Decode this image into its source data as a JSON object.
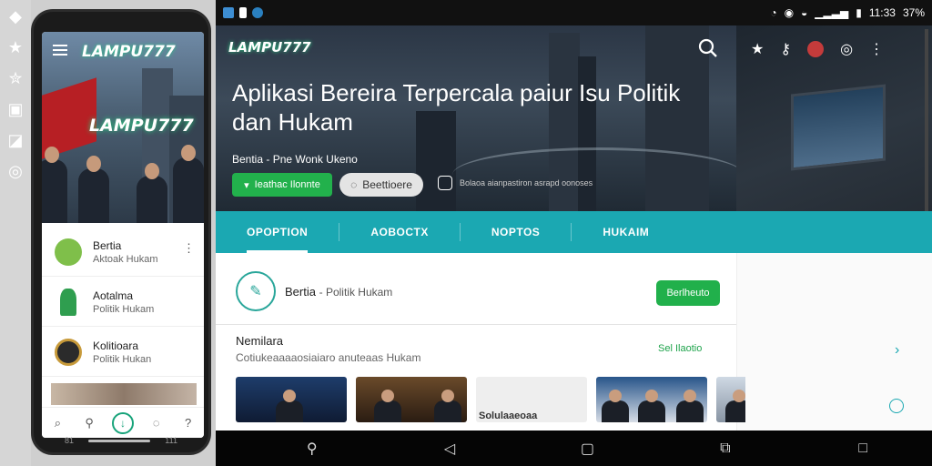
{
  "rail": {
    "icons": [
      "diamond-icon",
      "star-icon",
      "star-outline-icon",
      "briefcase-icon",
      "no-image-icon",
      "circle-dot-icon"
    ]
  },
  "phone": {
    "logo": "LAMPU777",
    "hero_logo": "LAMPU777",
    "list": [
      {
        "title": "Bertia",
        "subtitle": "Aktoak Hukam",
        "kebab": "⋮"
      },
      {
        "title": "Aotalma",
        "subtitle": "Politik Hukam",
        "kebab": ""
      },
      {
        "title": "Kolitioara",
        "subtitle": "Politik Hukan",
        "kebab": ""
      }
    ],
    "bottom_left": "81",
    "bottom_right": "111"
  },
  "status": {
    "time": "11:33",
    "pct": "37%"
  },
  "hero": {
    "logo": "LAMPU777",
    "title": "Aplikasi Bereira Terpercala paiur Isu Politik dan Hukam",
    "subtitle": "Bentia - Pne Wonk Ukeno",
    "btn_primary": "Ieathac Ilonnte",
    "btn_secondary": "Beettioere",
    "extra_text": "Bolaoa aianpastiron asrapd oonoses"
  },
  "tabs": [
    "OPOPTION",
    "AOBOCTX",
    "NOPTOS",
    "HUKAIM"
  ],
  "card": {
    "title": "Bertia",
    "subtitle": "Politik Hukam",
    "button": "Berlheuto"
  },
  "section": {
    "title": "Nemilara",
    "subtitle": "Cotiukeaaaaosiaiaro anuteaas Hukam",
    "link": "Sel Ilaotio"
  },
  "thumbs": [
    {
      "caption": ""
    },
    {
      "caption": ""
    },
    {
      "caption": "Solulaaeoaa"
    },
    {
      "caption": ""
    },
    {
      "caption": ""
    }
  ],
  "colors": {
    "accent": "#1ba8b2",
    "green": "#22b14c",
    "logo_glow": "#2fd18a"
  }
}
